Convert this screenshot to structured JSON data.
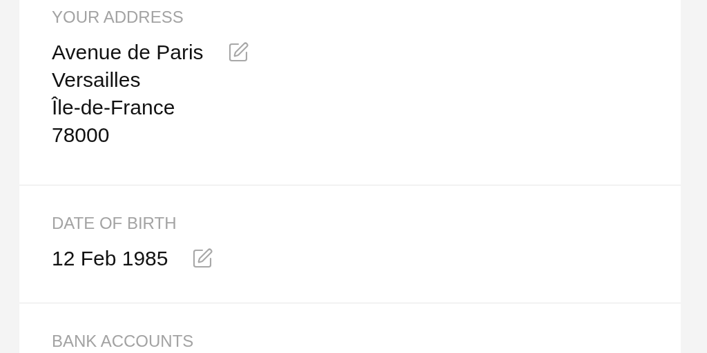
{
  "sections": [
    {
      "label": "YOUR ADDRESS",
      "lines": [
        "Avenue de Paris",
        "Versailles",
        "Île-de-France",
        "78000"
      ]
    },
    {
      "label": "DATE OF BIRTH",
      "lines": [
        "12 Feb 1985"
      ]
    },
    {
      "label": "BANK ACCOUNTS"
    }
  ]
}
